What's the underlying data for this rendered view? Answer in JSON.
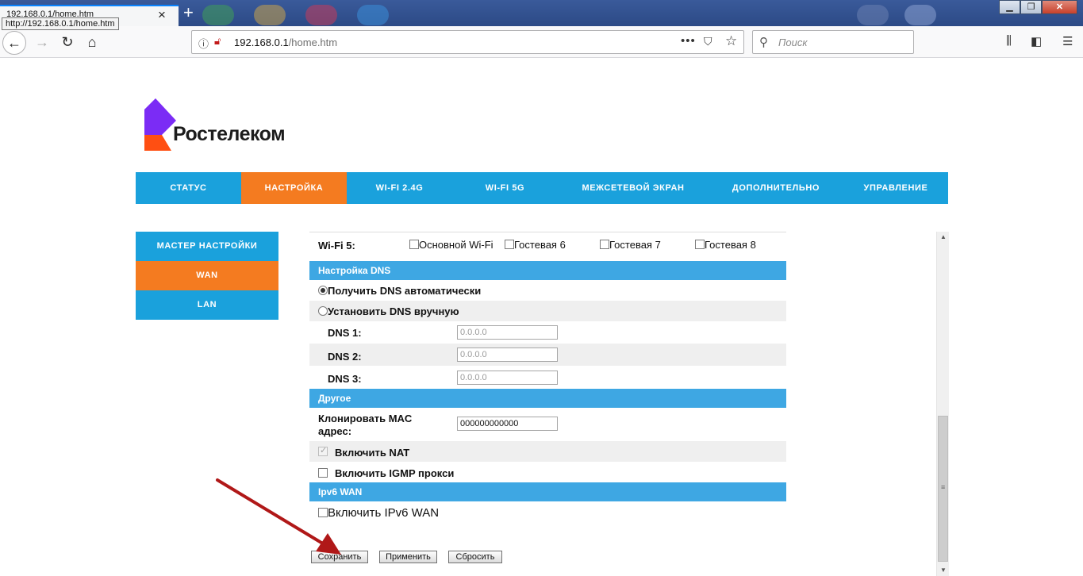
{
  "browser": {
    "tab_title": "192.168.0.1/home.htm",
    "tooltip": "http://192.168.0.1/home.htm",
    "url_host": "192.168.0.1",
    "url_path": "/home.htm",
    "search_placeholder": "Поиск"
  },
  "brand": {
    "name": "Ростелеком",
    "colors": {
      "purple": "#7b2cf5",
      "orange": "#ff4f12"
    }
  },
  "topnav": [
    {
      "label": "СТАТУС",
      "active": false
    },
    {
      "label": "НАСТРОЙКА",
      "active": true
    },
    {
      "label": "WI-FI 2.4G",
      "active": false
    },
    {
      "label": "WI-FI 5G",
      "active": false
    },
    {
      "label": "МЕЖСЕТЕВОЙ ЭКРАН",
      "active": false
    },
    {
      "label": "ДОПОЛНИТЕЛЬНО",
      "active": false
    },
    {
      "label": "УПРАВЛЕНИЕ",
      "active": false
    }
  ],
  "sidenav": [
    {
      "label": "МАСТЕР НАСТРОЙКИ",
      "active": false
    },
    {
      "label": "WAN",
      "active": true
    },
    {
      "label": "LAN",
      "active": false
    }
  ],
  "wifi5": {
    "label": "Wi-Fi 5:",
    "options": [
      "Основной Wi-Fi",
      "Гостевая 6",
      "Гостевая 7",
      "Гостевая 8"
    ]
  },
  "dns": {
    "section_title": "Настройка DNS",
    "auto_label": "Получить DNS автоматически",
    "manual_label": "Установить DNS вручную",
    "selected": "auto",
    "fields": [
      {
        "label": "DNS 1:",
        "placeholder": "0.0.0.0"
      },
      {
        "label": "DNS 2:",
        "placeholder": "0.0.0.0"
      },
      {
        "label": "DNS 3:",
        "placeholder": "0.0.0.0"
      }
    ]
  },
  "other": {
    "section_title": "Другое",
    "clone_mac_label": "Клонировать MAC адрес:",
    "clone_mac_value": "000000000000",
    "nat_label": "Включить NAT",
    "nat_checked": true,
    "igmp_label": "Включить IGMP прокси",
    "igmp_checked": false
  },
  "ipv6": {
    "section_title": "Ipv6 WAN",
    "enable_label": "Включить IPv6 WAN",
    "enable_checked": false
  },
  "buttons": {
    "save": "Сохранить",
    "apply": "Применить",
    "reset": "Сбросить"
  },
  "colors": {
    "nav_blue": "#1aa1dc",
    "active_orange": "#f47b20",
    "section_blue": "#3ea7e3",
    "annotation_arrow": "#b01818"
  }
}
